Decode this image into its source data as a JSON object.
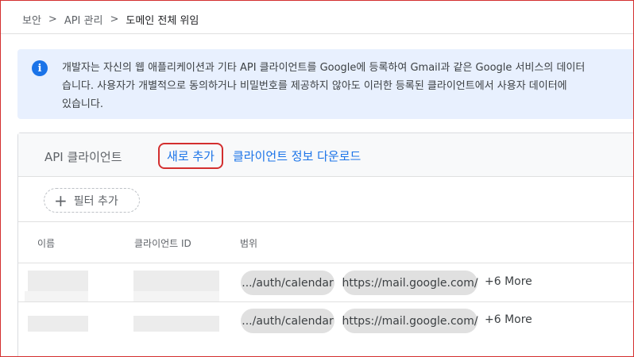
{
  "breadcrumb": {
    "items": [
      "보안",
      "API 관리",
      "도메인 전체 위임"
    ],
    "separator": ">"
  },
  "info_banner": {
    "icon": "info-icon",
    "icon_glyph": "i",
    "lines": [
      "개발자는 자신의 웹 애플리케이션과 기타 API 클라이언트를 Google에 등록하여 Gmail과 같은 Google 서비스의 데이터",
      "습니다. 사용자가 개별적으로 동의하거나 비밀번호를 제공하지 않아도 이러한 등록된 클라이언트에서 사용자 데이터에",
      "있습니다."
    ]
  },
  "card": {
    "title": "API 클라이언트",
    "add_new_label": "새로 추가",
    "download_label": "클라이언트 정보 다운로드",
    "filter_label": "필터 추가",
    "filter_icon": "plus-icon",
    "columns": [
      "이름",
      "클라이언트 ID",
      "범위"
    ],
    "rows": [
      {
        "scope1": ".../auth/calendar",
        "scope2": "https://mail.google.com/",
        "more": "+6 More"
      },
      {
        "scope1": ".../auth/calendar",
        "scope2": "https://mail.google.com/",
        "more": "+6 More"
      }
    ]
  },
  "colors": {
    "accent": "#1a73e8",
    "highlight_border": "#d32f2f",
    "banner_bg": "#e8f0fe",
    "chip_bg": "#e0e0e0"
  }
}
